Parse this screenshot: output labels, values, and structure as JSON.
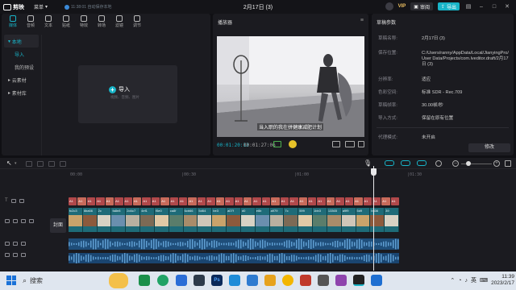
{
  "app": {
    "name": "剪映",
    "menu_label": "菜单",
    "save_status": "11:38:01 自动保存本地",
    "project_title": "2月17日 (3)",
    "vip_label": "VIP",
    "feedback_label": "审阅",
    "export_label": "导出"
  },
  "toolbar": {
    "tabs": [
      {
        "label": "媒体",
        "icon": "media-icon"
      },
      {
        "label": "音频",
        "icon": "audio-icon"
      },
      {
        "label": "文本",
        "icon": "text-icon"
      },
      {
        "label": "贴纸",
        "icon": "sticker-icon"
      },
      {
        "label": "特效",
        "icon": "effects-icon"
      },
      {
        "label": "转场",
        "icon": "transition-icon"
      },
      {
        "label": "滤镜",
        "icon": "filter-icon"
      },
      {
        "label": "调节",
        "icon": "adjust-icon"
      }
    ]
  },
  "sidebar": {
    "items": [
      {
        "label": "本地"
      },
      {
        "label": "导入"
      },
      {
        "label": "我的预设"
      },
      {
        "label": "云素材"
      },
      {
        "label": "素材库"
      }
    ]
  },
  "import": {
    "label": "导入",
    "hint": "视频、音频、图片"
  },
  "player": {
    "title": "播放器",
    "subtitle": "当入职的我在拼健康减肥计划",
    "current_time": "00:01:20:12",
    "total_time": "00:01:27:06"
  },
  "params": {
    "title": "草稿参数",
    "rows": [
      {
        "key": "草稿名称:",
        "value": "2月17日 (3)"
      },
      {
        "key": "保存位置:",
        "value": "C:/Users/ranny/AppData/Local/JianyingPro/User Data/Projects/com.lveditor.draft/2月17日 (3)"
      },
      {
        "key": "分辨率:",
        "value": "适应"
      },
      {
        "key": "色彩空间:",
        "value": "标准 SDR - Rec.709"
      },
      {
        "key": "草稿帧率:",
        "value": "30.00帧/秒"
      },
      {
        "key": "导入方式:",
        "value": "保留在原有位置"
      },
      {
        "key": "代理模式:",
        "value": "未开启"
      }
    ],
    "edit_label": "修改"
  },
  "timeline": {
    "ticks": [
      "00:00",
      "|00:30",
      "|01:00",
      "|01:30"
    ],
    "cover_label": "封面",
    "text_clips": [
      "A1",
      "A1",
      "A1",
      "A1",
      "A1",
      "A1",
      "A1",
      "A1",
      "A1",
      "A1",
      "A1",
      "A1",
      "A1",
      "A1",
      "A1",
      "A1",
      "A1",
      "A1",
      "A1",
      "A1",
      "A1",
      "A1",
      "A1",
      "A1",
      "A1",
      "A1",
      "A1",
      "A1",
      "A1",
      "A1",
      "A1",
      "A1",
      "A1",
      "A1",
      "A1",
      "A1"
    ],
    "video_clips": [
      "fc2c3",
      "6ba66",
      "2c",
      "fa8e8",
      "2d4c7",
      "4ef1",
      "f5e0",
      "ca8f",
      "6cb66",
      "5d64",
      "be3",
      "a07f",
      "d0",
      "e6b",
      "a979",
      "7c",
      "599",
      "1bb3",
      "13365",
      "a9f9",
      "5d9",
      "b536",
      "39"
    ]
  },
  "taskbar": {
    "search_label": "搜索",
    "ime_label": "英",
    "time": "11:39",
    "date": "2023/2/17"
  },
  "colors": {
    "accent": "#18b4c8",
    "text_clip": "#b0484a",
    "video_track": "#1e6b78",
    "audio_track": "#1f4e7a"
  }
}
